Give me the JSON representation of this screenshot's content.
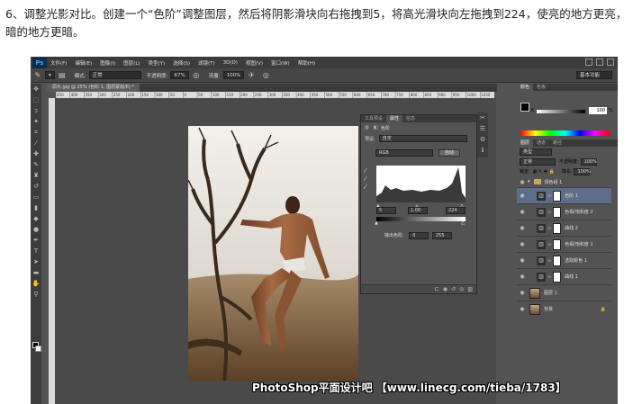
{
  "caption": "6、调整光影对比。创建一个“色阶”调整图层，然后将阴影滑块向右拖拽到5，将高光滑块向左拖拽到224，使亮的地方更亮，暗的地方更暗。",
  "app": {
    "logo": "Ps",
    "menu": [
      "文件(F)",
      "编辑(E)",
      "图像(I)",
      "图层(L)",
      "类型(Y)",
      "选择(S)",
      "滤镜(T)",
      "3D(D)",
      "视图(V)",
      "窗口(W)",
      "帮助(H)"
    ]
  },
  "options_bar": {
    "mode_label": "模式:",
    "mode_value": "正常",
    "opacity_label": "不透明度:",
    "opacity_value": "67%",
    "flow_label": "流量:",
    "flow_value": "100%",
    "workspace": "基本功能"
  },
  "document": {
    "tab_title": "原片.jpg @ 25% (色阶 1, 图层蒙版/8) *",
    "ruler_ticks": [
      "450",
      "400",
      "350",
      "300",
      "250",
      "200",
      "150",
      "100",
      "50",
      "0",
      "50",
      "100",
      "150",
      "200",
      "250",
      "300",
      "350",
      "400",
      "450",
      "500",
      "550",
      "600",
      "650",
      "700",
      "750",
      "800",
      "850",
      "900",
      "950",
      "1000",
      "1050"
    ]
  },
  "properties": {
    "tabs": [
      "工具预设",
      "属性",
      "信息"
    ],
    "active_tab": 1,
    "title": "色阶",
    "preset_label": "预设:",
    "preset_value": "自定",
    "channel_value": "RGB",
    "auto_button": "自动",
    "shadow_input": "5",
    "midtone_input": "1.00",
    "highlight_input": "224",
    "output_label": "输出色阶:",
    "output_low": "0",
    "output_high": "255"
  },
  "color_panel": {
    "tabs": [
      "颜色",
      "色板"
    ],
    "k_label": "K",
    "k_value": "100",
    "k_unit": "%"
  },
  "layers_panel": {
    "tabs": [
      "图层",
      "通道",
      "路径"
    ],
    "filter_label": "类型",
    "blend_mode": "正常",
    "opacity_label": "不透明度:",
    "opacity_value": "100%",
    "lock_label": "锁定:",
    "fill_label": "填充:",
    "fill_value": "100%",
    "group_name": "调色组 1",
    "layers": [
      {
        "name": "色阶 1",
        "icon": "levels-icon",
        "selected": true
      },
      {
        "name": "色相/饱和度 2",
        "icon": "hue-saturation-icon",
        "selected": false
      },
      {
        "name": "曲线 2",
        "icon": "curves-icon",
        "selected": false
      },
      {
        "name": "色相/饱和度 1",
        "icon": "hue-saturation-icon",
        "selected": false
      },
      {
        "name": "选取颜色 1",
        "icon": "selective-color-icon",
        "selected": false
      },
      {
        "name": "曲线 1",
        "icon": "curves-icon",
        "selected": false
      }
    ],
    "image_layers": [
      {
        "name": "图层 1"
      },
      {
        "name": "背景"
      }
    ]
  },
  "watermark": "PhotoShop平面设计吧 【www.linecg.com/tieba/1783】"
}
